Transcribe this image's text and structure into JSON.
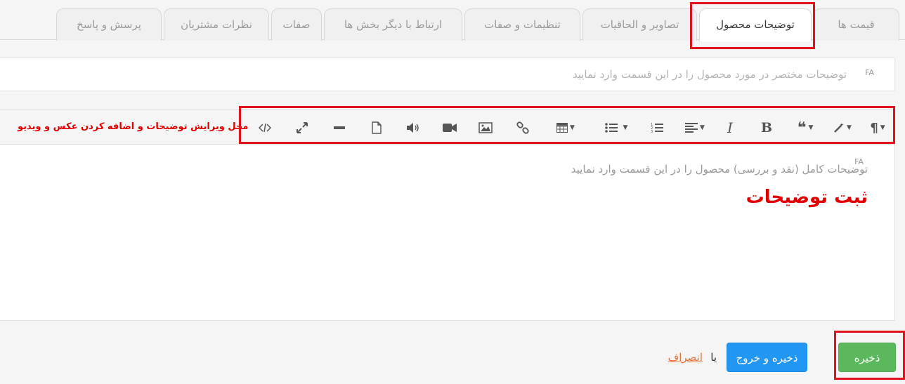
{
  "tabs": [
    {
      "label": "قیمت ها",
      "active": false
    },
    {
      "label": "توضیحات محصول",
      "active": true
    },
    {
      "label": "تصاویر و الحاقیات",
      "active": false
    },
    {
      "label": "تنظیمات و صفات",
      "active": false
    },
    {
      "label": "ارتباط با دیگر بخش ها",
      "active": false
    },
    {
      "label": "صفات",
      "active": false
    },
    {
      "label": "نظرات مشتریان",
      "active": false
    },
    {
      "label": "پرسش و پاسخ",
      "active": false
    }
  ],
  "short_description": {
    "lang_tag": "FA",
    "placeholder": "توضیحات مختصر در مورد محصول را در این قسمت وارد نمایید"
  },
  "editor": {
    "toolbar_note": "محل ویرایش توضیحات و اضافه کردن عکس و ویدیو",
    "lang_tag": "FA",
    "placeholder": "توضیحات کامل (نقد و بررسی) محصول را در این قسمت وارد نمایید",
    "annotation": "ثبت توضیحات",
    "toolbar_icons": [
      "paragraph-icon",
      "magic-icon",
      "quote-icon",
      "bold-icon",
      "italic-icon",
      "align-icon",
      "ordered-list-icon",
      "unordered-list-icon",
      "table-icon",
      "link-icon",
      "image-icon",
      "video-icon",
      "audio-icon",
      "file-icon",
      "horizontal-rule-icon",
      "fullscreen-icon",
      "code-view-icon"
    ]
  },
  "footer": {
    "save_label": "ذخیره",
    "save_exit_label": "ذخیره و خروج",
    "or_text": "یا",
    "cancel_label": "انصراف"
  },
  "colors": {
    "save": "#5cb85c",
    "save_exit": "#2196f3",
    "annotation_red": "#e0121b",
    "cancel_link": "#e8743b"
  }
}
